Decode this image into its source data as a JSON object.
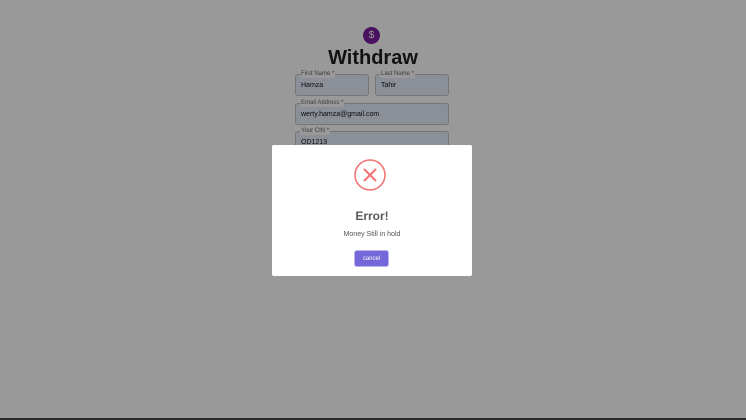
{
  "page": {
    "logo_symbol": "$",
    "title": "Withdraw",
    "fields": {
      "first_name": {
        "label": "First Name *",
        "value": "Hamza"
      },
      "last_name": {
        "label": "Last Name *",
        "value": "Tahir"
      },
      "email": {
        "label": "Email Address *",
        "value": "werty.hamza@gmail.com"
      },
      "cin": {
        "label": "Your CIN *",
        "value": "OD1213"
      }
    }
  },
  "modal": {
    "icon": "error-x-icon",
    "title": "Error!",
    "message": "Money Still in hold",
    "button_label": "cancel"
  },
  "colors": {
    "brand": "#7b1fa2",
    "error_icon": "#f27474",
    "button": "#7367d9",
    "overlay": "rgba(0,0,0,0.4)"
  }
}
